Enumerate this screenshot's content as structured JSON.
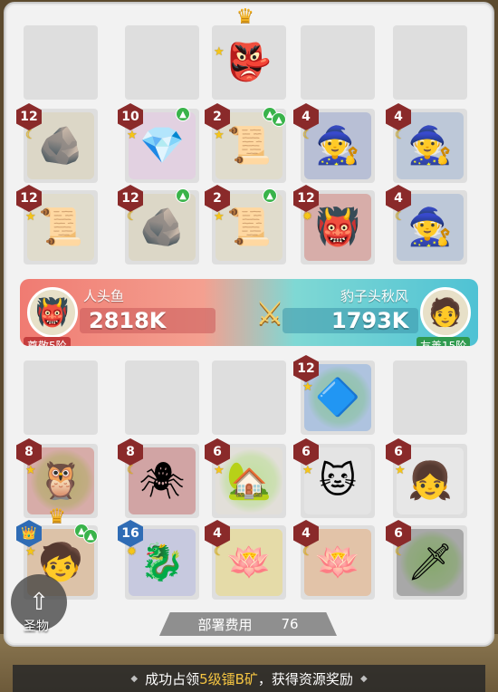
{
  "board": {
    "rows": [
      [
        {
          "empty": true
        },
        {
          "empty": true
        },
        {
          "name": "goblin-chief",
          "glyph": "👺",
          "crown": true,
          "rank": "star"
        },
        {
          "empty": true
        },
        {
          "empty": true
        }
      ],
      [
        {
          "name": "gold-rune-stone",
          "glyph": "🪨",
          "level": "12",
          "rank": "moon",
          "bg": "#d9c89a"
        },
        {
          "name": "crystal-egg",
          "glyph": "💎",
          "level": "10",
          "rank": "star",
          "up": 1,
          "bg": "#e9b6e8"
        },
        {
          "name": "crystal-scroll",
          "glyph": "📜",
          "level": "2",
          "rank": "star",
          "up": 2,
          "bg": "#e4d7a8"
        },
        {
          "name": "wizard-hat-mage",
          "glyph": "🧙",
          "level": "4",
          "rank": "moon",
          "bg": "#6d80c4"
        },
        {
          "name": "witch-slime",
          "glyph": "🧙",
          "level": "4",
          "rank": "moon",
          "bg": "#7c9bcc"
        }
      ],
      [
        {
          "name": "gold-rune-scroll",
          "glyph": "📜",
          "level": "12",
          "rank": "star",
          "bg": "#e4d7a8"
        },
        {
          "name": "gold-rune-stone",
          "glyph": "🪨",
          "level": "12",
          "rank": "moon",
          "up": 1,
          "bg": "#d9c89a"
        },
        {
          "name": "crystal-scroll",
          "glyph": "📜",
          "level": "2",
          "rank": "star",
          "up": 1,
          "bg": "#e4d7a8"
        },
        {
          "name": "demon-warlord",
          "glyph": "👹",
          "level": "12",
          "rank": "sun",
          "bg": "#c94b3e"
        },
        {
          "name": "witch-slime",
          "glyph": "🧙",
          "level": "4",
          "rank": "moon",
          "bg": "#7c9bcc"
        }
      ],
      [
        {
          "empty": true
        },
        {
          "empty": true
        },
        {
          "empty": true
        },
        {
          "name": "blue-crystal",
          "glyph": "🔷",
          "level": "12",
          "rank": "star",
          "heart": true,
          "bg": "#4d8ee0"
        },
        {
          "empty": true
        }
      ],
      [
        {
          "name": "owl-bell",
          "glyph": "🦉",
          "level": "8",
          "rank": "star",
          "heart": true,
          "bg": "#c8473b"
        },
        {
          "name": "spider-hand",
          "glyph": "🕷",
          "level": "8",
          "rank": "moon",
          "bg": "#b8312f"
        },
        {
          "name": "cottage",
          "glyph": "🏡",
          "level": "6",
          "rank": "star",
          "heart": true,
          "bg": "#e9e1cf"
        },
        {
          "name": "cat-photo",
          "glyph": "🐱",
          "level": "6",
          "rank": "star",
          "bg": "#efefef"
        },
        {
          "name": "girl-photo",
          "glyph": "👧",
          "level": "6",
          "rank": "star",
          "bg": "#fafafa"
        }
      ],
      [
        {
          "name": "calabash-brother",
          "glyph": "🧒",
          "level": "👑",
          "level_color": "blue",
          "rank": "star",
          "crown": true,
          "up": 2,
          "bg": "#d88a3c"
        },
        {
          "name": "azure-dragon",
          "glyph": "🐉",
          "level": "16",
          "level_color": "blue",
          "rank": "sun",
          "bg": "#9aa0e0"
        },
        {
          "name": "rainbow-lotus-hearts",
          "glyph": "🪷",
          "level": "4",
          "rank": "moon",
          "bg": "#f2d43d"
        },
        {
          "name": "rainbow-lotus",
          "glyph": "🪷",
          "level": "4",
          "rank": "moon",
          "bg": "#e98c3c"
        },
        {
          "name": "jagged-blade",
          "glyph": "🗡",
          "level": "6",
          "rank": "moon",
          "heart": true,
          "bg": "#3c3c3c"
        }
      ]
    ]
  },
  "battle": {
    "left": {
      "name": "人头鱼",
      "power": "2818K",
      "relation": "尊敬5阶",
      "avatar_icon": "👹"
    },
    "right": {
      "name": "豹子头秋风",
      "power": "1793K",
      "relation": "友善15阶",
      "avatar_icon": "🧑"
    },
    "colors": {
      "left": "#f07b72",
      "right": "#4fc2d4"
    }
  },
  "relic": {
    "label": "圣物"
  },
  "cost": {
    "label": "部署费用",
    "value": "76"
  },
  "toast": {
    "prefix": "成功占领",
    "highlight": "5级镭B矿",
    "suffix": "，获得资源奖励"
  }
}
